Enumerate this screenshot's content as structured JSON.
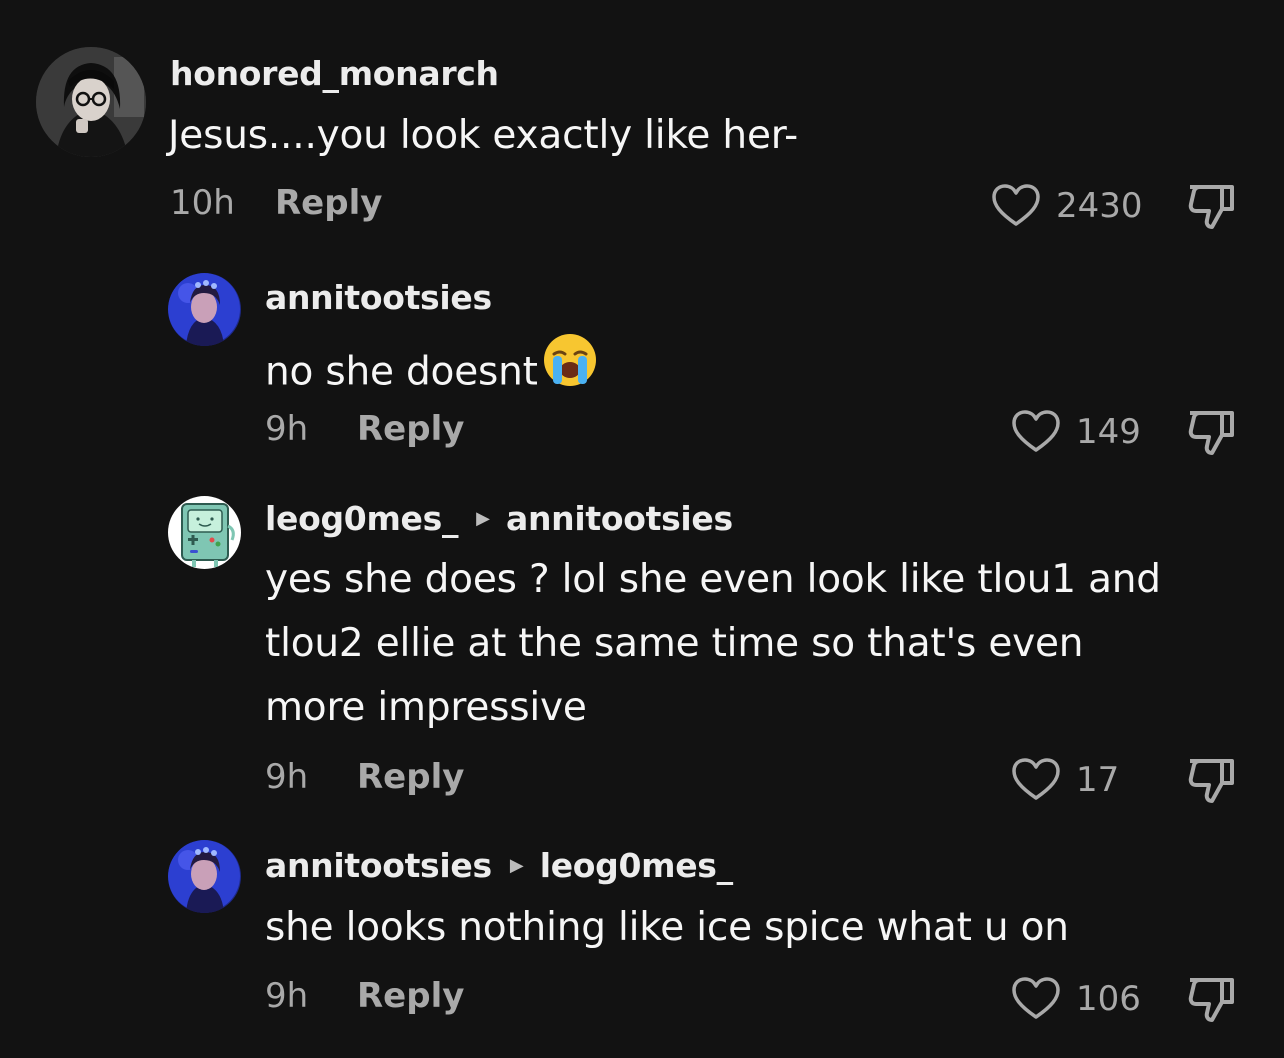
{
  "comments": [
    {
      "username": "honored_monarch",
      "reply_to": "",
      "text": "Jesus....you look exactly like her-",
      "time": "10h",
      "reply_label": "Reply",
      "likes": "2430",
      "avatar_icon": "avatar-dark-hair-glasses",
      "like_icon": "heart-outline-icon",
      "dislike_icon": "thumbs-down-icon"
    },
    {
      "username": "annitootsies",
      "reply_to": "",
      "text": "no she doesnt",
      "emoji": "loudly-crying-face",
      "time": "9h",
      "reply_label": "Reply",
      "likes": "149",
      "avatar_icon": "avatar-blue-photo",
      "like_icon": "heart-outline-icon",
      "dislike_icon": "thumbs-down-icon"
    },
    {
      "username": "leog0mes_",
      "reply_to": "annitootsies",
      "text_lines": [
        "yes she does ? lol she even look like tlou1 and",
        "tlou2 ellie at the same time so that's even",
        "more impressive"
      ],
      "time": "9h",
      "reply_label": "Reply",
      "likes": "17",
      "avatar_icon": "avatar-bmo-robot",
      "like_icon": "heart-outline-icon",
      "dislike_icon": "thumbs-down-icon"
    },
    {
      "username": "annitootsies",
      "reply_to": "leog0mes_",
      "text": "she looks nothing like ice spice what u on",
      "time": "9h",
      "reply_label": "Reply",
      "likes": "106",
      "avatar_icon": "avatar-blue-photo",
      "like_icon": "heart-outline-icon",
      "dislike_icon": "thumbs-down-icon"
    }
  ],
  "colors": {
    "background": "#121212",
    "username": "#ececec",
    "body": "#f6f6f6",
    "meta": "#a9a9a9"
  }
}
